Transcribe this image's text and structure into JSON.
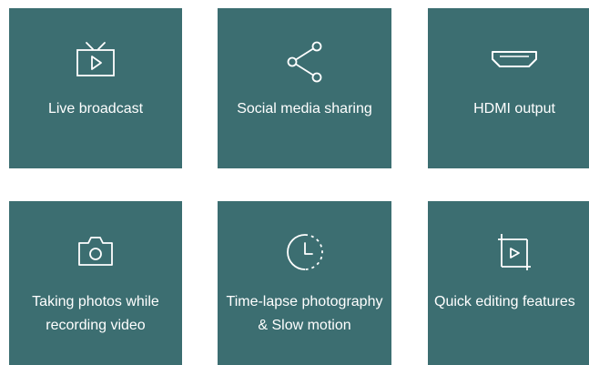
{
  "colors": {
    "tile_background": "#3c6e71",
    "text": "#ffffff",
    "page_background": "#ffffff"
  },
  "features": [
    {
      "icon": "tv-icon",
      "label": "Live broadcast"
    },
    {
      "icon": "share-icon",
      "label": "Social media sharing"
    },
    {
      "icon": "hdmi-icon",
      "label": "HDMI output"
    },
    {
      "icon": "camera-icon",
      "label": "Taking photos while recording video"
    },
    {
      "icon": "timelapse-clock-icon",
      "label": "Time-lapse photography & Slow motion"
    },
    {
      "icon": "crop-play-icon",
      "label": "Quick editing features"
    }
  ]
}
